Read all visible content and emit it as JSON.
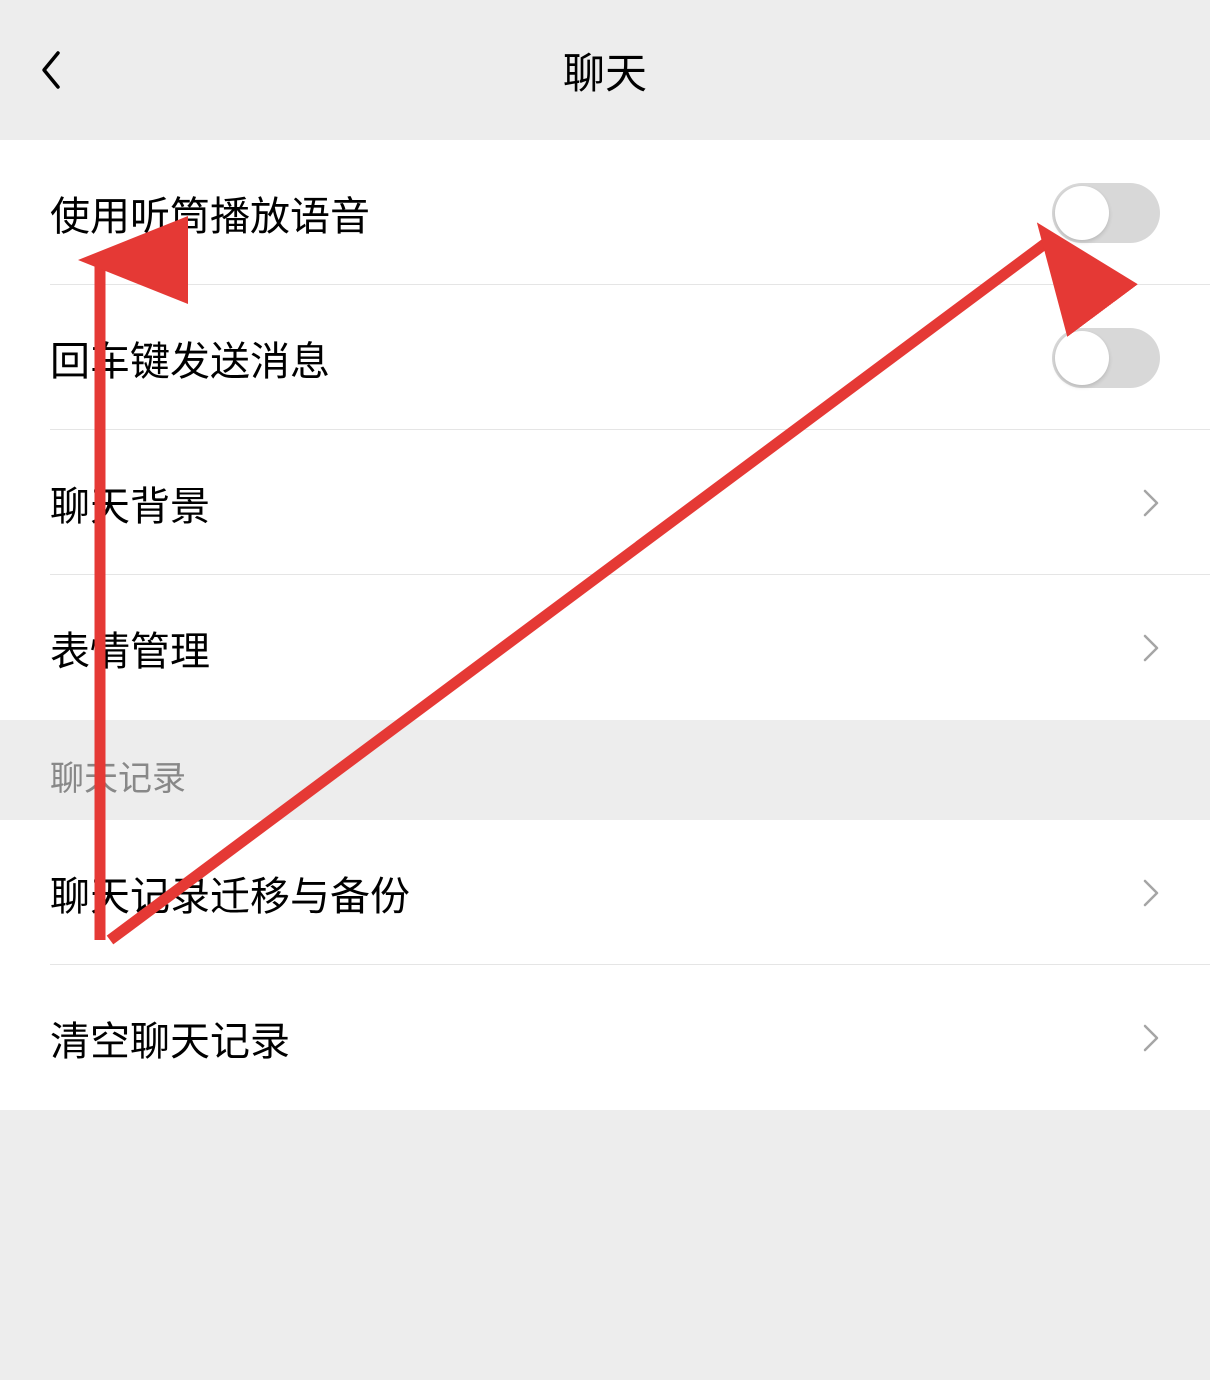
{
  "header": {
    "title": "聊天"
  },
  "settings": {
    "earpiece_voice": {
      "label": "使用听筒播放语音",
      "enabled": false
    },
    "enter_to_send": {
      "label": "回车键发送消息",
      "enabled": false
    },
    "chat_background": {
      "label": "聊天背景"
    },
    "sticker_management": {
      "label": "表情管理"
    }
  },
  "section_chat_history": {
    "title": "聊天记录"
  },
  "history_settings": {
    "migrate_backup": {
      "label": "聊天记录迁移与备份"
    },
    "clear_history": {
      "label": "清空聊天记录"
    }
  },
  "annotation": {
    "color": "#e53935"
  }
}
